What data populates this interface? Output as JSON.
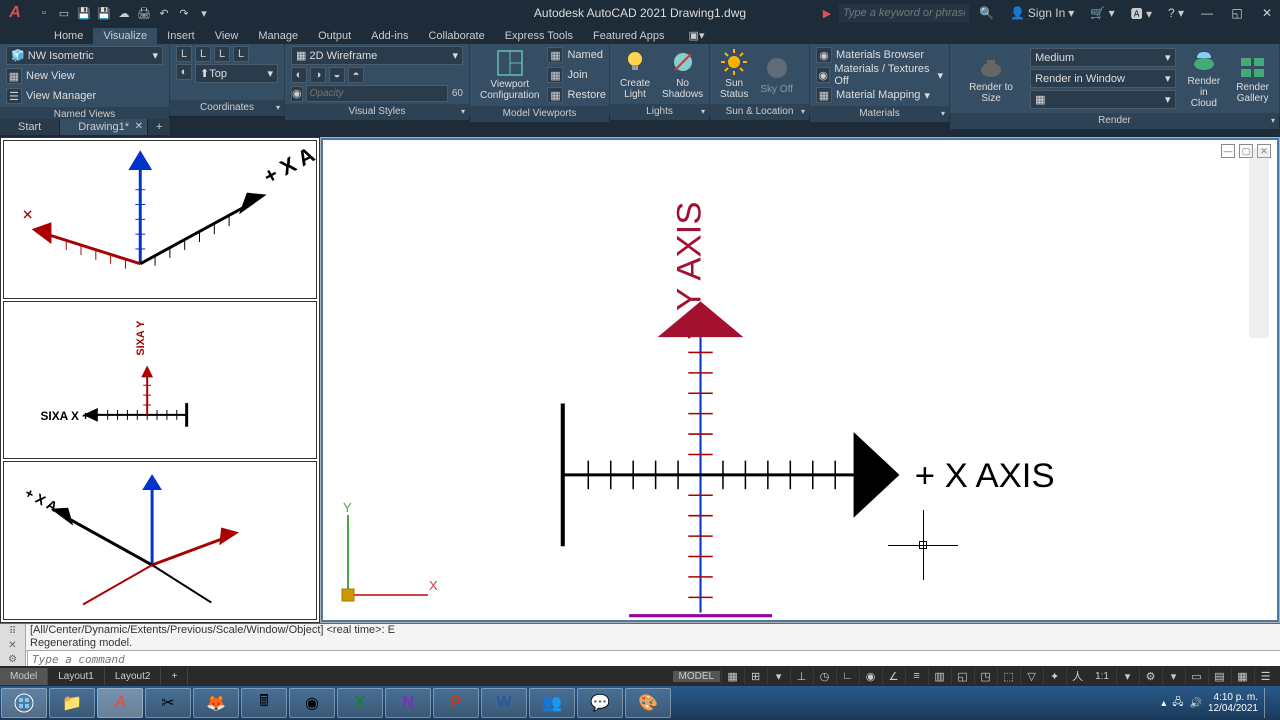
{
  "app": {
    "title": "Autodesk AutoCAD 2021   Drawing1.dwg"
  },
  "search": {
    "placeholder": "Type a keyword or phrase"
  },
  "signin": {
    "label": "Sign In"
  },
  "menu": {
    "items": [
      "Home",
      "Visualize",
      "Insert",
      "View",
      "Manage",
      "Output",
      "Add-ins",
      "Collaborate",
      "Express Tools",
      "Featured Apps"
    ],
    "active": 1
  },
  "ribbon": {
    "named_views": {
      "combo": "NW Isometric",
      "new_view": "New View",
      "view_manager": "View Manager",
      "panel": "Named Views"
    },
    "coords": {
      "top": "Top",
      "panel": "Coordinates"
    },
    "visual_styles": {
      "combo": "2D Wireframe",
      "opacity": "Opacity",
      "opacity_val": "60",
      "panel": "Visual Styles"
    },
    "viewports": {
      "config": "Viewport\nConfiguration",
      "named": "Named",
      "join": "Join",
      "restore": "Restore",
      "panel": "Model Viewports"
    },
    "lights": {
      "create": "Create\nLight",
      "noshadows": "No\nShadows",
      "panel": "Lights"
    },
    "sun": {
      "status": "Sun\nStatus",
      "skyoff": "Sky Off",
      "panel": "Sun & Location"
    },
    "materials": {
      "browser": "Materials Browser",
      "textures": "Materials / Textures Off",
      "mapping": "Material Mapping",
      "panel": "Materials"
    },
    "render": {
      "size": "Render to Size",
      "quality": "Medium",
      "target": "Render in Window",
      "cloud": "Render in\nCloud",
      "gallery": "Render\nGallery",
      "panel": "Render"
    }
  },
  "filetabs": {
    "start": "Start",
    "drawing": "Drawing1*"
  },
  "canvas": {
    "y_label": "+ Y AXIS",
    "x_label": "+ X AXIS"
  },
  "cmd": {
    "hist1": "[All/Center/Dynamic/Extents/Previous/Scale/Window/Object] <real time>: E",
    "hist2": "Regenerating model.",
    "placeholder": "Type a command"
  },
  "layouts": {
    "model": "Model",
    "l1": "Layout1",
    "l2": "Layout2"
  },
  "status": {
    "model": "MODEL",
    "scale": "1:1"
  },
  "tray": {
    "time": "4:10 p. m.",
    "date": "12/04/2021"
  }
}
